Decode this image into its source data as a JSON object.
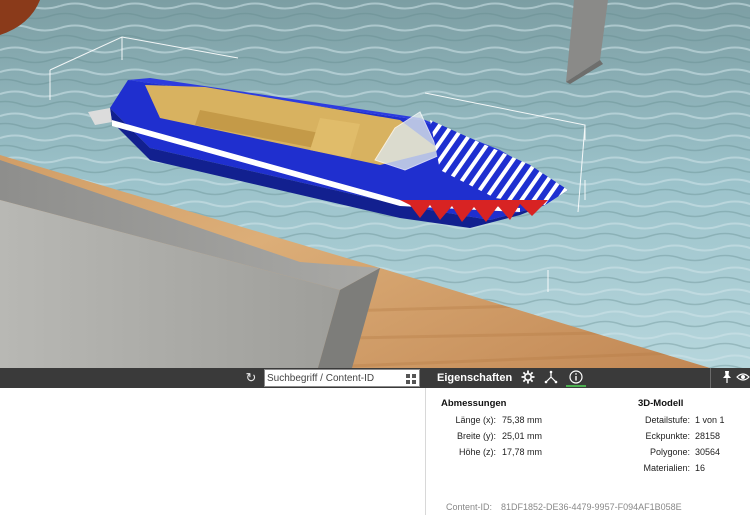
{
  "toolbar": {
    "search_placeholder": "Suchbegriff / Content-ID",
    "properties_tab": "Eigenschaften"
  },
  "icons": {
    "refresh": "refresh-icon",
    "grid": "grid-view-icon",
    "settings": "gear-icon",
    "hierarchy": "node-tree-icon",
    "info": "info-icon",
    "pin": "pin-icon",
    "eye": "eye-icon"
  },
  "properties": {
    "dimensions": {
      "title": "Abmessungen",
      "rows": [
        {
          "label": "Länge (x):",
          "value": "75,38 mm"
        },
        {
          "label": "Breite (y):",
          "value": "25,01 mm"
        },
        {
          "label": "Höhe (z):",
          "value": "17,78 mm"
        }
      ]
    },
    "model": {
      "title": "3D-Modell",
      "rows": [
        {
          "label": "Detailstufe:",
          "value": "1 von 1"
        },
        {
          "label": "Eckpunkte:",
          "value": "28158"
        },
        {
          "label": "Polygone:",
          "value": "30564"
        },
        {
          "label": "Materialien:",
          "value": "16"
        }
      ]
    },
    "content_id_label": "Content-ID:",
    "content_id": "81DF1852-DE36-4479-9957-F094AF1B058E"
  },
  "colors": {
    "toolbar_bg": "#3a3a3a",
    "active_tab_underline": "#4caf50",
    "boat_hull": "#1f2fcf",
    "boat_deck": "#d8b260",
    "water": "#8cb6c0",
    "dock_wood": "#c8955e",
    "concrete": "#9a9a98"
  }
}
